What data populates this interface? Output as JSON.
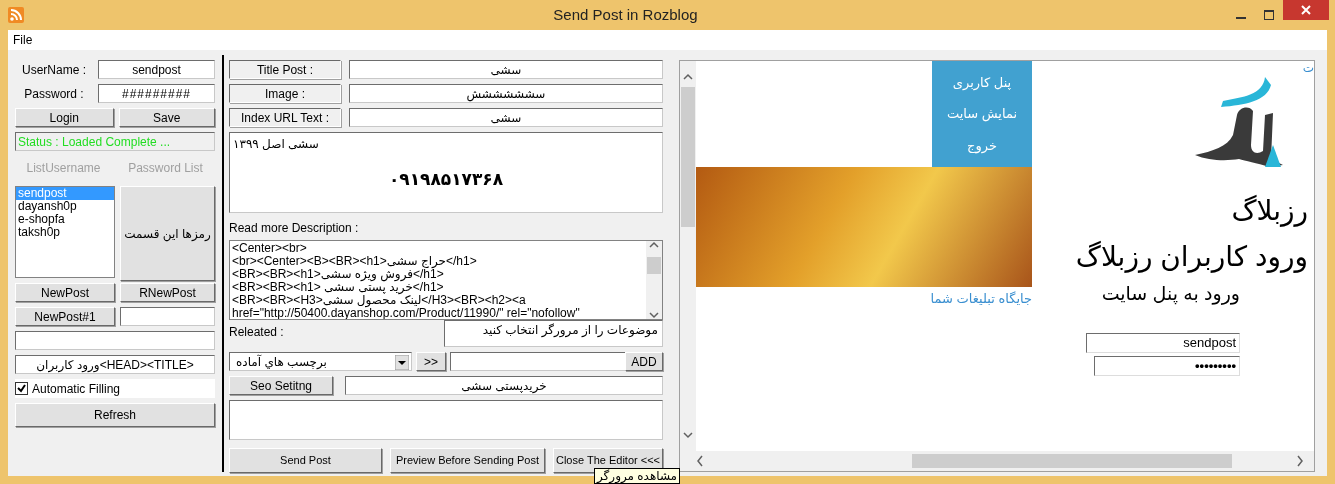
{
  "window": {
    "title": "Send Post in Rozblog"
  },
  "menu": [
    "File"
  ],
  "login": {
    "username_label": "UserName :",
    "username": "sendpost",
    "password_label": "Password :",
    "password": "#########"
  },
  "login_button": "Login",
  "save_button": "Save",
  "status": "Status : Loaded Complete ...",
  "username_list_label": {
    "text": "ListUsername",
    "disabled": true
  },
  "password_list_label": {
    "text": "Password List",
    "disabled": true
  },
  "accounts": [
    {
      "name": "sendpost",
      "selected": true
    },
    {
      "name": "dayansh0p",
      "selected": false
    },
    {
      "name": "e-shopfa",
      "selected": false
    },
    {
      "name": "taksh0p",
      "selected": false
    }
  ],
  "passwords_button": "رمزها این قسمت",
  "newpost_button": "NewPost",
  "rnewpost_button": "RNewPost",
  "newpost1_button": "NewPost#1",
  "head_field": "ورود کاربران<HEAD><TITLE>",
  "automatic_filling": {
    "label": "Automatic Filling",
    "checked": true
  },
  "refresh_button": "Refresh",
  "fields": [
    {
      "label": "Title Post :",
      "value": "سشی"
    },
    {
      "label": "Image :",
      "value": "سشششششش"
    },
    {
      "label": "Index URL Text :",
      "value": "سشی"
    }
  ],
  "index_text": {
    "note": "سشی اصل ۱۳۹۹",
    "phone": "۰۹۱۹۸۵۱۷۳۶۸"
  },
  "description_label": "Read more Description :",
  "description_lines": [
    "<Center><br>",
    "<br><Center><B><BR><h1>حراج سشی</h1>",
    "<BR><BR><h1>فروش ویژه سشی</h1>",
    "<BR><BR><h1> خرید پستی سشی</h1>",
    "<BR><BR><H3>لینک محصول سشی</H3><BR><h2><a",
    "href=\"http://50400.dayanshop.com/Product/11990/\" rel=\"nofollow\""
  ],
  "related_label": "Releated :",
  "related_hint": "موضوعات را از مرورگر انتخاب کنید",
  "tags_combo": "برچسب هاي آماده",
  "move_button": ">>",
  "add_button": "ADD",
  "seo_button": "Seo Setitng",
  "seo_value": "خریدپستی سشی",
  "send_post_button": "Send Post",
  "preview_button": "Preview Before Sending Post",
  "close_editor_button": "Close The Editor <<<",
  "tooltip": "مشاهده مرورگر",
  "browser": {
    "corner_link": "ت",
    "menu": [
      "پنل کاربری",
      "نمایش سایت",
      "خروج"
    ],
    "ad_link": "جایگاه تبلیغات شما",
    "site_title": "رزبلاگ",
    "heading": "ورود کاربران رزبلاگ",
    "subheading": "ورود به پنل سایت",
    "username": "sendpost",
    "password": "•••••••••"
  }
}
